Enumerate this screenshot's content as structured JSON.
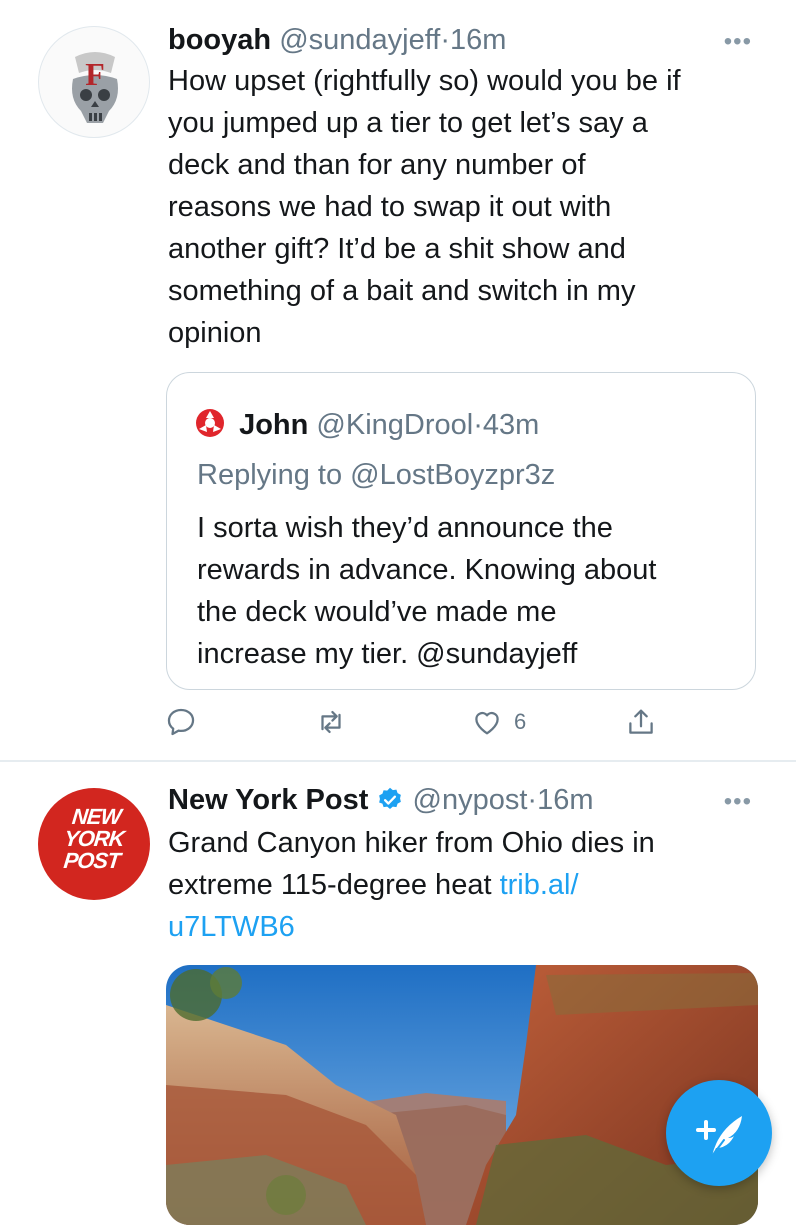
{
  "tweet1": {
    "name": "booyah",
    "handle": "@sundayjeff",
    "dot": "·",
    "time": "16m",
    "more": "•••",
    "lines": [
      "How upset (rightfully so) would you be if",
      "you jumped up a tier to get let’s say a",
      "deck and than for any number of",
      "reasons we had to swap it out with",
      "another gift? It’d be a shit show and",
      "something of a bait and switch in my",
      "opinion"
    ],
    "avatar_letter": "F",
    "quote": {
      "name": "John",
      "handle": "@KingDrool",
      "dot": "·",
      "time": "43m",
      "replying": "Replying to @LostBoyzpr3z",
      "lines": [
        "I sorta wish they’d announce the",
        "rewards in advance. Knowing about",
        "the deck would’ve made me",
        "increase my tier. @sundayjeff"
      ]
    },
    "like_count": "6",
    "icons": {
      "reply": "reply-icon",
      "retweet": "retweet-icon",
      "like": "heart-icon",
      "share": "share-icon"
    }
  },
  "tweet2": {
    "name": "New York Post",
    "handle": "@nypost",
    "dot": "·",
    "time": "16m",
    "more": "•••",
    "line1": "Grand Canyon hiker from Ohio dies in",
    "line2_text": "extreme 115-degree heat ",
    "line2_link": "trib.al/",
    "line3_link": "u7LTWB6",
    "logo_lines": [
      "NEW",
      "YORK",
      "POST"
    ]
  },
  "colors": {
    "accent": "#1da1f2",
    "secondary_text": "#657786",
    "nypost_red": "#d2261f"
  }
}
